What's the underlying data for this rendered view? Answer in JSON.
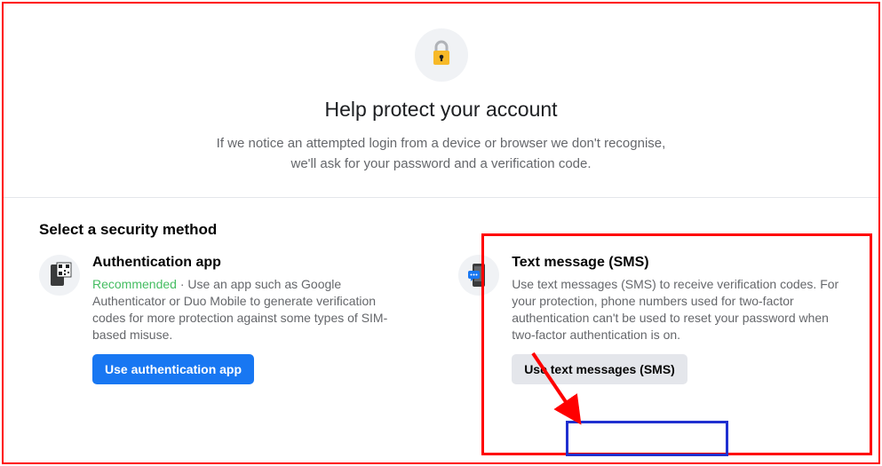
{
  "header": {
    "title": "Help protect your account",
    "description": "If we notice an attempted login from a device or browser we don't recognise, we'll ask for your password and a verification code."
  },
  "methods": {
    "heading": "Select a security method",
    "app": {
      "title": "Authentication app",
      "recommended": "Recommended",
      "desc_rest": " · Use an app such as Google Authenticator or Duo Mobile to generate verification codes for more protection against some types of SIM-based misuse.",
      "button": "Use authentication app"
    },
    "sms": {
      "title": "Text message (SMS)",
      "desc": "Use text messages (SMS) to receive verification codes. For your protection, phone numbers used for two-factor authentication can't be used to reset your password when two-factor authentication is on.",
      "button": "Use text messages (SMS)"
    }
  }
}
